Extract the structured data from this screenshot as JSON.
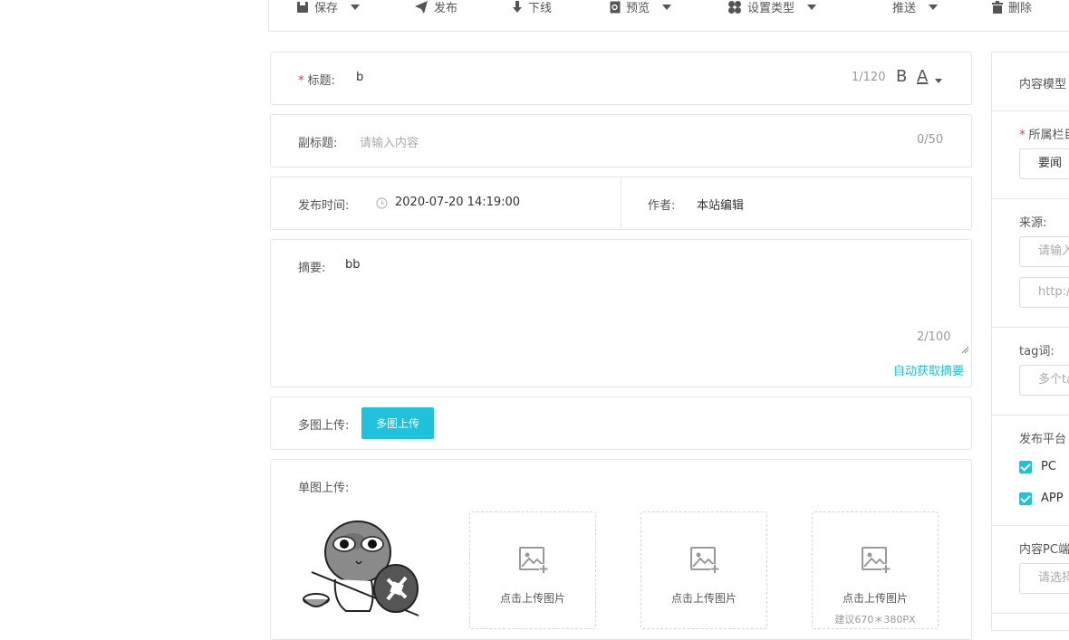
{
  "toolbar": {
    "save": "保存",
    "publish": "发布",
    "offline": "下线",
    "preview": "预览",
    "set_type": "设置类型",
    "push": "推送",
    "delete": "删除"
  },
  "title_field": {
    "label": "标题:",
    "required_mark": "*",
    "value": "b",
    "count": "1/120",
    "bold": "B",
    "font_color": "A"
  },
  "subtitle_field": {
    "label": "副标题:",
    "placeholder": "请输入内容",
    "count": "0/50"
  },
  "publish_time": {
    "label": "发布时间:",
    "value": "2020-07-20 14:19:00"
  },
  "author": {
    "label": "作者:",
    "value": "本站编辑"
  },
  "summary": {
    "label": "摘要:",
    "value": "bb",
    "count": "2/100",
    "auto_link": "自动获取摘要"
  },
  "multi_upload": {
    "label": "多图上传:",
    "button": "多图上传"
  },
  "single_upload": {
    "label": "单图上传:",
    "box_text": "点击上传图片",
    "hint": "建议670＊380PX"
  },
  "side": {
    "content_model": "内容模型",
    "column_label": "所属栏目",
    "required_mark": "*",
    "column_value": "要闻",
    "source_label": "来源:",
    "source_placeholder": "请输入",
    "source_url_placeholder": "http://",
    "tag_label": "tag词:",
    "tag_placeholder": "多个tag",
    "platform_label": "发布平台",
    "platforms": [
      "PC",
      "APP"
    ],
    "pc_content_label": "内容PC端",
    "pc_content_placeholder": "请选择"
  },
  "colors": {
    "accent": "#1fc1dc",
    "required": "#e53935"
  }
}
